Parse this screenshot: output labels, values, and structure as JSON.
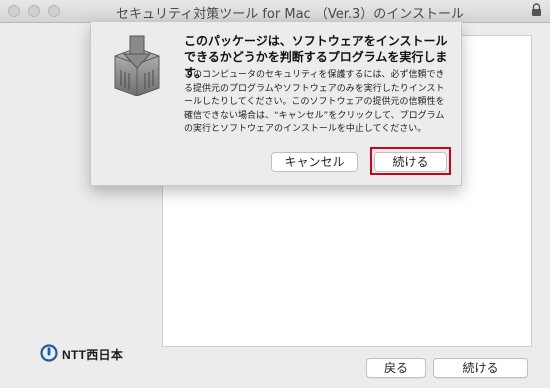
{
  "window": {
    "title": "セキュリティ対策ツール for Mac （Ver.3）のインストール"
  },
  "dialog": {
    "title": "このパッケージは、ソフトウェアをインストールできるかどうかを判断するプログラムを実行します。",
    "body": "このコンピュータのセキュリティを保護するには、必ず信頼できる提供元のプログラムやソフトウェアのみを実行したりインストールしたりしてください。このソフトウェアの提供元の信頼性を確信できない場合は、“キャンセル”をクリックして、プログラムの実行とソフトウェアのインストールを中止してください。",
    "cancel_label": "キャンセル",
    "continue_label": "続ける",
    "icon": "package-installer-icon",
    "highlight_color": "#d0021b"
  },
  "footer": {
    "back_label": "戻る",
    "continue_label": "続ける"
  },
  "logo": {
    "text": "NTT西日本",
    "icon": "ntt-logo-icon",
    "color": "#1a5aa6"
  }
}
